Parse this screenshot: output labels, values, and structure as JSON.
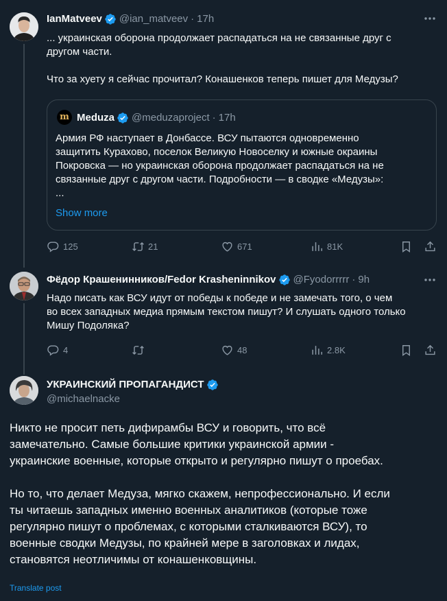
{
  "tweets": [
    {
      "name": "IanMatveev",
      "handle": "@ian_matveev",
      "dot": "·",
      "time": "17h",
      "text": "... украинская оборона продолжает распадаться на не связанные друг с\nдругом части.\n\nЧто за хуету я сейчас прочитал? Конашенков теперь пишет для Медузы?",
      "quote": {
        "logo": "m",
        "name": "Meduza",
        "handle": "@meduzaproject",
        "dot": "·",
        "time": "17h",
        "text": "Армия РФ наступает в Донбассе. ВСУ пытаются одновременно\nзащитить Курахово, поселок Великую Новоселку и южные окраины\nПокровска — но украинская оборона продолжает распадаться на не\nсвязанные друг с другом части. Подробности — в сводке «Медузы»:\n...",
        "show_more": "Show more"
      },
      "stats": {
        "replies": "125",
        "reposts": "21",
        "likes": "671",
        "views": "81K"
      }
    },
    {
      "name": "Фёдор Крашенинников/Fedor Krasheninnikov",
      "handle": "@Fyodorrrrr",
      "dot": "·",
      "time": "9h",
      "text": "Надо писать как ВСУ идут от победы к победе и не замечать того, о чем\nво всех западных медиа прямым текстом пишут? И слушать одного только\nМишу Подоляка?",
      "stats": {
        "replies": "4",
        "reposts": "",
        "likes": "48",
        "views": "2.8K"
      }
    },
    {
      "name": "УКРАИНСКИЙ ПРОПАГАНДИСТ",
      "handle": "@michaelnacke",
      "text": "Никто не просит петь дифирамбы ВСУ и говорить, что всё\nзамечательно. Самые большие критики украинской армии -\nукраинские военные, которые открыто и регулярно пишут о проебах.\n\nНо то, что делает Медуза, мягко скажем, непрофессионально. И если\nты читаешь западных именно военных аналитиков (которые тоже\nрегулярно пишут о проблемах, с которыми сталкиваются ВСУ), то\nвоенные сводки Медузы, по крайней мере в заголовках и лидах,\nстановятся неотличимы от конашенковщины.",
      "translate": "Translate post"
    }
  ],
  "icons": {
    "verified": "verified-badge-icon",
    "more": "more-options-icon",
    "reply": "reply-icon",
    "repost": "repost-icon",
    "like": "like-icon",
    "views": "views-icon",
    "bookmark": "bookmark-icon",
    "share": "share-icon"
  },
  "colors": {
    "background": "#15202b",
    "text": "#f7f9f9",
    "secondary": "#8b98a5",
    "accent": "#1d9bf0",
    "border": "#38444d"
  }
}
